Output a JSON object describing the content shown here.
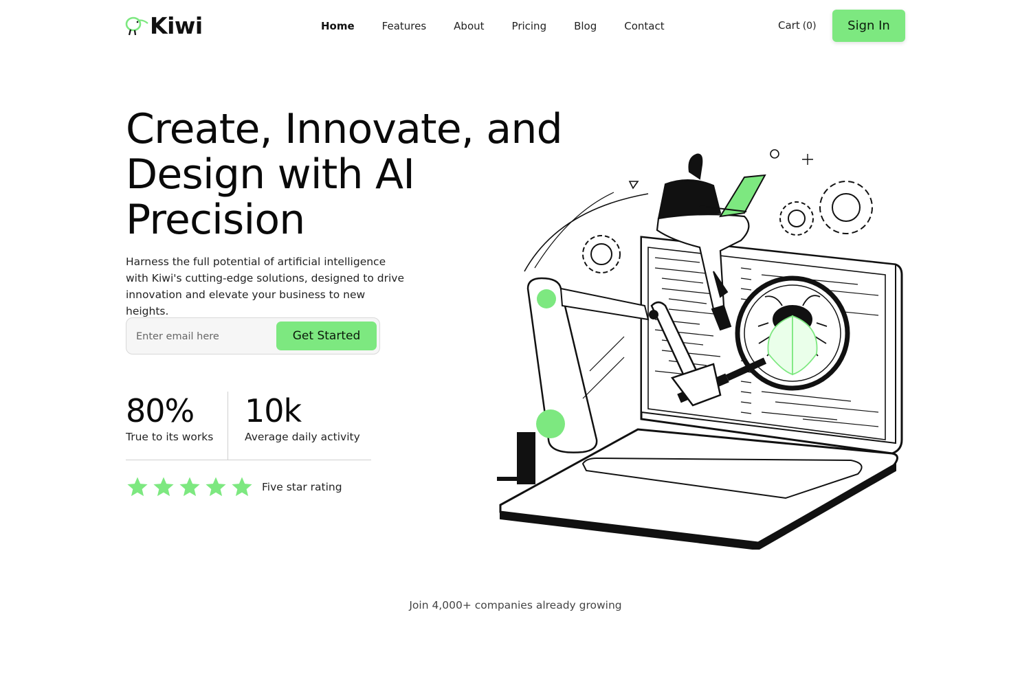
{
  "header": {
    "brand": "Kiwi",
    "nav": [
      {
        "label": "Home",
        "active": true
      },
      {
        "label": "Features",
        "active": false
      },
      {
        "label": "About",
        "active": false
      },
      {
        "label": "Pricing",
        "active": false
      },
      {
        "label": "Blog",
        "active": false
      },
      {
        "label": "Contact",
        "active": false
      }
    ],
    "cart_label": "Cart",
    "cart_count": "(0)",
    "signin_label": "Sign In"
  },
  "hero": {
    "title": "Create, Innovate, and Design with AI Precision",
    "subtitle": "Harness the full potential of artificial intelligence with Kiwi's cutting-edge solutions, designed to drive innovation and elevate your business to new heights.",
    "email_placeholder": "Enter email here",
    "cta_label": "Get Started"
  },
  "stats": [
    {
      "value": "80%",
      "label": "True to its works"
    },
    {
      "value": "10k",
      "label": "Average daily activity"
    }
  ],
  "rating": {
    "stars": 5,
    "label": "Five star rating"
  },
  "footer_note": "Join 4,000+ companies already growing",
  "colors": {
    "accent": "#7de880",
    "text": "#111111",
    "muted": "#444444",
    "border": "#d9d9d9"
  },
  "icons": {
    "logo": "kiwi-bird-icon",
    "star": "star-icon",
    "hero_art": "robot-arm-laptop-bug-illustration"
  }
}
